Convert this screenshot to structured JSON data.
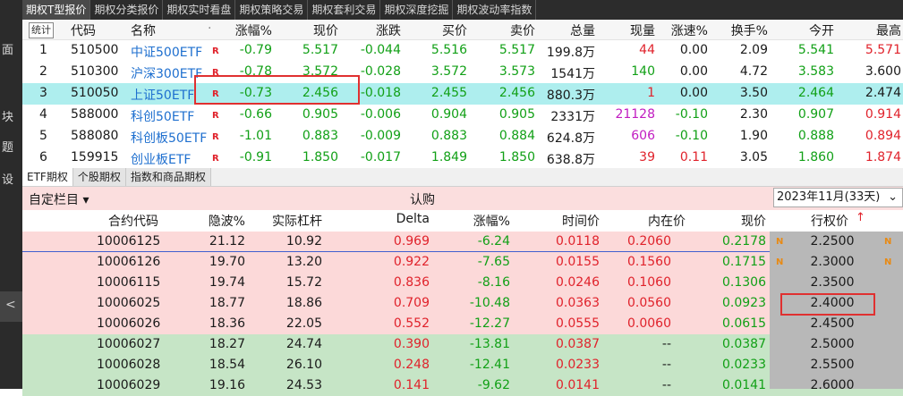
{
  "top_tabs": [
    "期权T型报价",
    "期权分类报价",
    "期权实时看盘",
    "期权策略交易",
    "期权套利交易",
    "期权深度挖掘",
    "期权波动率指数"
  ],
  "left_sidebar": [
    "面",
    "块",
    "题",
    "设"
  ],
  "left_sidebar_selected": "<",
  "quote_table": {
    "stat_button": "统计",
    "headers": [
      "代码",
      "名称",
      "·",
      "涨幅%",
      "现价",
      "涨跌",
      "买价",
      "卖价",
      "总量",
      "现量",
      "涨速%",
      "换手%",
      "今开",
      "最高"
    ],
    "rows": [
      {
        "idx": "1",
        "code": "510500",
        "name": "中证500ETF",
        "flag": "R",
        "chg_pct": "-0.79",
        "price": "5.517",
        "chg": "-0.044",
        "bid": "5.516",
        "ask": "5.517",
        "vol": "199.8万",
        "cur": "44",
        "speed": "0.00",
        "turnover": "2.09",
        "open": "5.541",
        "high": "5.571"
      },
      {
        "idx": "2",
        "code": "510300",
        "name": "沪深300ETF",
        "flag": "R",
        "chg_pct": "-0.78",
        "price": "3.572",
        "chg": "-0.028",
        "bid": "3.572",
        "ask": "3.573",
        "vol": "1541万",
        "cur": "140",
        "speed": "0.00",
        "turnover": "4.72",
        "open": "3.583",
        "high": "3.600"
      },
      {
        "idx": "3",
        "code": "510050",
        "name": "上证50ETF",
        "flag": "R",
        "chg_pct": "-0.73",
        "price": "2.456",
        "chg": "-0.018",
        "bid": "2.455",
        "ask": "2.456",
        "vol": "880.3万",
        "cur": "1",
        "speed": "0.00",
        "turnover": "3.50",
        "open": "2.464",
        "high": "2.474"
      },
      {
        "idx": "4",
        "code": "588000",
        "name": "科创50ETF",
        "flag": "R",
        "chg_pct": "-0.66",
        "price": "0.905",
        "chg": "-0.006",
        "bid": "0.904",
        "ask": "0.905",
        "vol": "2331万",
        "cur": "21128",
        "speed": "-0.10",
        "turnover": "2.30",
        "open": "0.907",
        "high": "0.914"
      },
      {
        "idx": "5",
        "code": "588080",
        "name": "科创板50ETF",
        "flag": "R",
        "chg_pct": "-1.01",
        "price": "0.883",
        "chg": "-0.009",
        "bid": "0.883",
        "ask": "0.884",
        "vol": "624.8万",
        "cur": "606",
        "speed": "-0.10",
        "turnover": "1.90",
        "open": "0.888",
        "high": "0.894"
      },
      {
        "idx": "6",
        "code": "159915",
        "name": "创业板ETF",
        "flag": "R",
        "chg_pct": "-0.91",
        "price": "1.850",
        "chg": "-0.017",
        "bid": "1.849",
        "ask": "1.850",
        "vol": "638.8万",
        "cur": "39",
        "speed": "0.11",
        "turnover": "3.05",
        "open": "1.860",
        "high": "1.874"
      }
    ]
  },
  "sub_tabs": [
    "ETF期权",
    "个股期权",
    "指数和商品期权"
  ],
  "custom_columns_label": "自定栏目 ▾",
  "call_label": "认购",
  "expiry_select": "2023年11月(33天)",
  "options_table": {
    "headers": [
      "合约代码",
      "隐波%",
      "实际杠杆",
      "Delta",
      "涨幅%",
      "时间价",
      "内在价",
      "现价",
      "行权价"
    ],
    "rows": [
      {
        "code": "10006125",
        "iv": "21.12",
        "lev": "10.92",
        "delta": "0.969",
        "chg": "-6.24",
        "tv": "0.0118",
        "iv2": "0.2060",
        "price": "0.2178",
        "strike": "2.2500",
        "n": "N"
      },
      {
        "code": "10006126",
        "iv": "19.70",
        "lev": "13.20",
        "delta": "0.922",
        "chg": "-7.65",
        "tv": "0.0155",
        "iv2": "0.1560",
        "price": "0.1715",
        "strike": "2.3000",
        "n": "N"
      },
      {
        "code": "10006115",
        "iv": "19.74",
        "lev": "15.72",
        "delta": "0.836",
        "chg": "-8.16",
        "tv": "0.0246",
        "iv2": "0.1060",
        "price": "0.1306",
        "strike": "2.3500",
        "n": ""
      },
      {
        "code": "10006025",
        "iv": "18.77",
        "lev": "18.86",
        "delta": "0.709",
        "chg": "-10.48",
        "tv": "0.0363",
        "iv2": "0.0560",
        "price": "0.0923",
        "strike": "2.4000",
        "n": ""
      },
      {
        "code": "10006026",
        "iv": "18.36",
        "lev": "22.05",
        "delta": "0.552",
        "chg": "-12.27",
        "tv": "0.0555",
        "iv2": "0.0060",
        "price": "0.0615",
        "strike": "2.4500",
        "n": ""
      },
      {
        "code": "10006027",
        "iv": "18.27",
        "lev": "24.74",
        "delta": "0.390",
        "chg": "-13.81",
        "tv": "0.0387",
        "iv2": "--",
        "price": "0.0387",
        "strike": "2.5000",
        "n": ""
      },
      {
        "code": "10006028",
        "iv": "18.54",
        "lev": "26.10",
        "delta": "0.248",
        "chg": "-12.41",
        "tv": "0.0233",
        "iv2": "--",
        "price": "0.0233",
        "strike": "2.5500",
        "n": ""
      },
      {
        "code": "10006029",
        "iv": "19.16",
        "lev": "24.53",
        "delta": "0.141",
        "chg": "-9.62",
        "tv": "0.0141",
        "iv2": "--",
        "price": "0.0141",
        "strike": "2.6000",
        "n": ""
      }
    ]
  },
  "colors": {
    "up": "#e0222b",
    "down": "#11a016",
    "highlight_row": "#aeeeee",
    "itm_band": "#fcd9d9",
    "otm_band": "#c6e5c6",
    "strike_col": "#b8b8b8",
    "box": "#e03030"
  }
}
